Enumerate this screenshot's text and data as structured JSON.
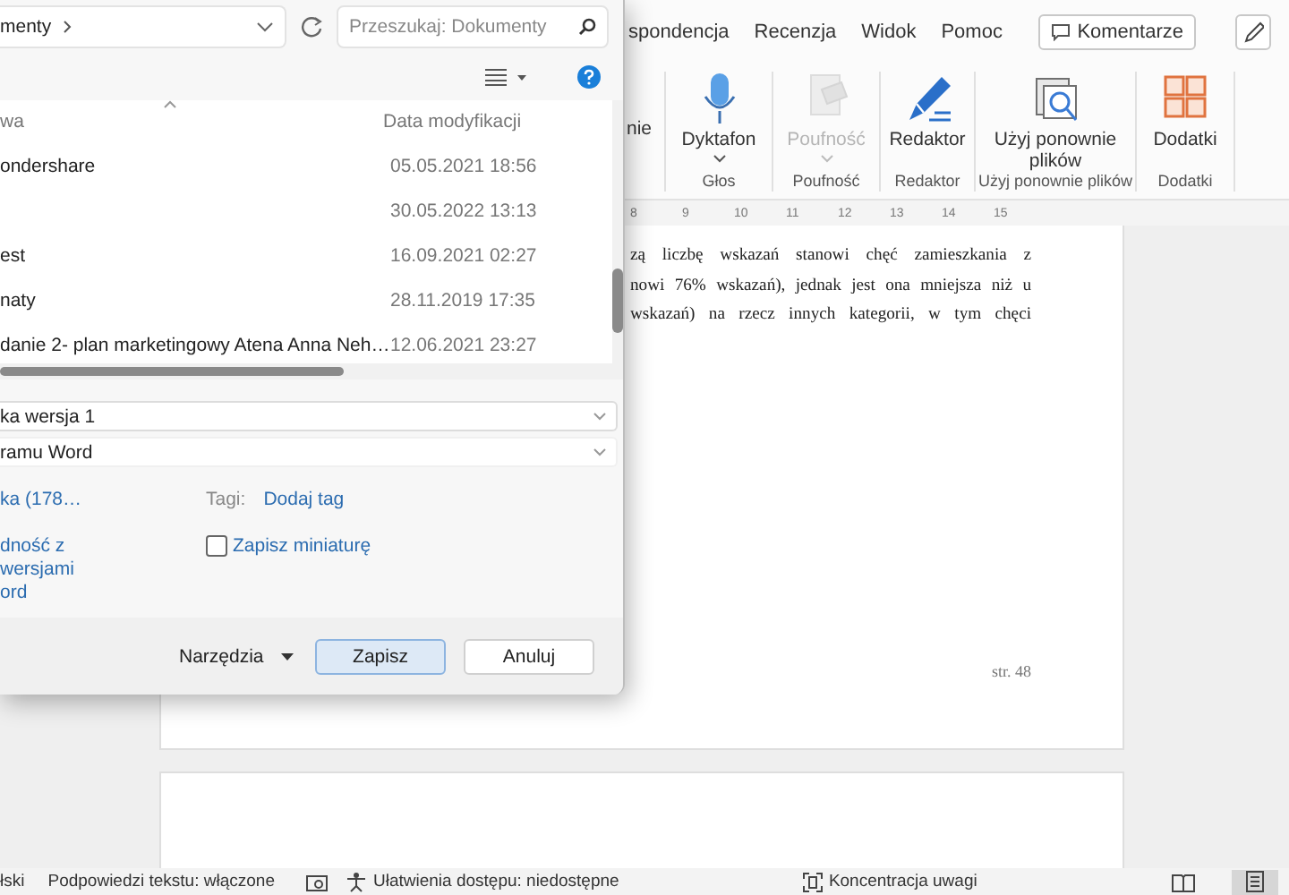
{
  "word": {
    "tabs": [
      "spondencja",
      "Recenzja",
      "Widok",
      "Pomoc"
    ],
    "comments_button": "Komentarze",
    "ribbon": {
      "cut_label": "nie",
      "groups": [
        {
          "label": "Głos",
          "command": {
            "kind": "dictate",
            "label": "Dyktafon",
            "disabled": false,
            "dropdown": true
          }
        },
        {
          "label": "Poufność",
          "command": {
            "kind": "sensitivity",
            "label": "Poufność",
            "disabled": true,
            "dropdown": true
          }
        },
        {
          "label": "Redaktor",
          "command": {
            "kind": "editor",
            "label": "Redaktor",
            "disabled": false,
            "dropdown": false
          }
        },
        {
          "label": "Użyj ponownie plików",
          "command": {
            "kind": "reuse",
            "label": "Użyj ponownie plików",
            "disabled": false,
            "dropdown": false
          }
        },
        {
          "label": "Dodatki",
          "command": {
            "kind": "addins",
            "label": "Dodatki",
            "disabled": false,
            "dropdown": false
          }
        }
      ]
    },
    "ruler": [
      "8",
      "9",
      "10",
      "11",
      "12",
      "13",
      "14",
      "15"
    ],
    "document": {
      "lines": [
        "zą liczbę wskazań stanowi chęć zamieszkania z",
        "nowi 76% wskazań), jednak jest ona mniejsza niż u",
        "wskazań) na rzecz innych kategorii, w tym chęci"
      ],
      "page_number": "str. 48"
    },
    "status_bar": {
      "language": "łski",
      "text_predictions": "Podpowiedzi tekstu: włączone",
      "accessibility": "Ułatwienia dostępu: niedostępne",
      "focus": "Koncentracja uwagi",
      "views": [
        {
          "kind": "read",
          "selected": false
        },
        {
          "kind": "print",
          "selected": true
        }
      ]
    }
  },
  "save_dialog": {
    "address": "menty",
    "search": {
      "placeholder": "Przeszukaj: Dokumenty"
    },
    "columns": [
      "wa",
      "Data modyfikacji"
    ],
    "files": [
      {
        "name": "ondershare",
        "modified": "05.05.2021 18:56"
      },
      {
        "modified": "30.05.2022 13:13"
      },
      {
        "name": "est",
        "modified": "16.09.2021 02:27"
      },
      {
        "name": "naty",
        "modified": "28.11.2019 17:35"
      },
      {
        "name": "danie 2- plan marketingowy Atena Anna Neh…",
        "modified": "12.06.2021 23:27"
      }
    ],
    "file_name": "ka wersja 1",
    "file_type": "ramu Word",
    "authors": "ka (178…",
    "tags_label": "Tagi:",
    "tags_value": "Dodaj tag",
    "compatibility_lines": [
      "dność z",
      "wersjami",
      "ord"
    ],
    "thumbnail": {
      "label": "Zapisz miniaturę",
      "checked": false
    },
    "tools": "Narzędzia",
    "save": "Zapisz",
    "cancel": "Anuluj"
  }
}
